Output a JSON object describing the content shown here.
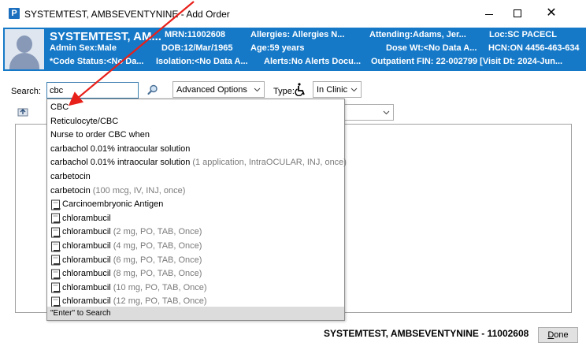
{
  "window": {
    "app_icon_letter": "P",
    "title": "SYSTEMTEST, AMBSEVENTYNINE - Add Order",
    "minimize_icon": "minimize-icon",
    "maximize_icon": "maximize-icon",
    "close_icon": "close-icon",
    "close_glyph": "✕"
  },
  "banner": {
    "name": "SYSTEMTEST, AM...",
    "line1": [
      {
        "text": "MRN:11002608"
      },
      {
        "text": "Allergies: Allergies N..."
      },
      {
        "text": "Attending:Adams, Jer..."
      },
      {
        "text": "Loc:SC PACECL"
      }
    ],
    "line2": [
      {
        "text": "Admin Sex:Male"
      },
      {
        "text": "DOB:12/Mar/1965"
      },
      {
        "text": "Age:59 years"
      },
      {
        "text": "Dose Wt:<No Data A..."
      },
      {
        "text": "HCN:ON 4456-463-634"
      }
    ],
    "line3": [
      {
        "text": "*Code Status:<No Da..."
      },
      {
        "text": "Isolation:<No Data A..."
      },
      {
        "text": "Alerts:No Alerts Docu..."
      },
      {
        "text": "Outpatient FIN: 22-002799 [Visit Dt: 2024-Jun..."
      }
    ],
    "bg_color": "#1679c8"
  },
  "search": {
    "label": "Search:",
    "value": "cbc",
    "icon": "magnifier-icon",
    "advanced_label": "Advanced Options",
    "type_label": "Type:",
    "type_icon": "wheelchair-icon",
    "type_value": "In Clinic"
  },
  "suggestions": {
    "items": [
      {
        "name": "CBC",
        "detail": "",
        "icon": false
      },
      {
        "name": "Reticulocyte/CBC",
        "detail": "",
        "icon": false
      },
      {
        "name": "Nurse to order CBC when",
        "detail": "",
        "icon": false
      },
      {
        "name": "carbachol 0.01% intraocular solution",
        "detail": "",
        "icon": false
      },
      {
        "name": "carbachol 0.01% intraocular solution",
        "detail": "(1 application, IntraOCULAR, INJ, once)",
        "icon": false
      },
      {
        "name": "carbetocin",
        "detail": "",
        "icon": false
      },
      {
        "name": "carbetocin",
        "detail": "(100 mcg, IV, INJ, once)",
        "icon": false
      },
      {
        "name": "Carcinoembryonic Antigen",
        "detail": "",
        "icon": true
      },
      {
        "name": "chlorambucil",
        "detail": "",
        "icon": true
      },
      {
        "name": "chlorambucil",
        "detail": "(2 mg, PO, TAB, Once)",
        "icon": true
      },
      {
        "name": "chlorambucil",
        "detail": "(4 mg, PO, TAB, Once)",
        "icon": true
      },
      {
        "name": "chlorambucil",
        "detail": "(6 mg, PO, TAB, Once)",
        "icon": true
      },
      {
        "name": "chlorambucil",
        "detail": "(8 mg, PO, TAB, Once)",
        "icon": true
      },
      {
        "name": "chlorambucil",
        "detail": "(10 mg, PO, TAB, Once)",
        "icon": true
      },
      {
        "name": "chlorambucil",
        "detail": "(12 mg, PO, TAB, Once)",
        "icon": true
      }
    ],
    "footer": "\"Enter\" to Search"
  },
  "footer": {
    "patient": "SYSTEMTEST, AMBSEVENTYNINE - 11002608",
    "done_prefix": "D",
    "done_rest": "one"
  },
  "annotation": {
    "arrow_color": "#e8201a"
  }
}
